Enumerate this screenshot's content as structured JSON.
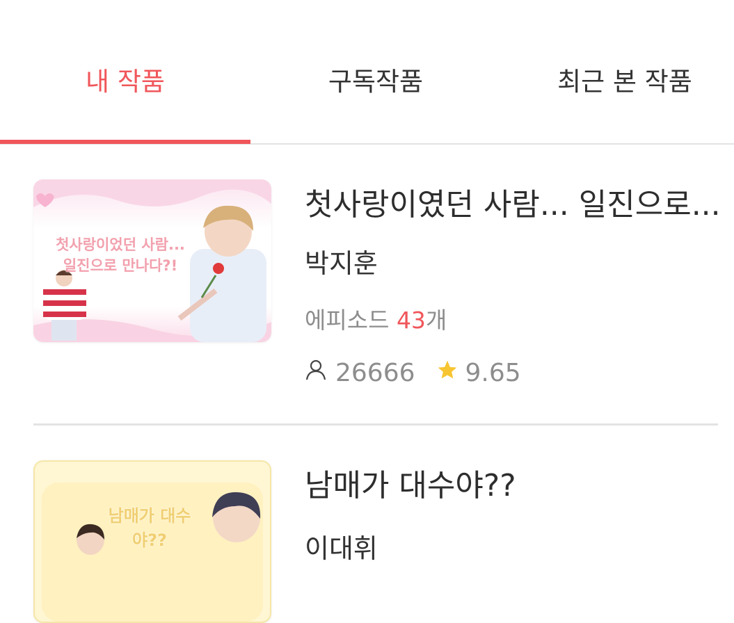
{
  "tabs": [
    {
      "label": "내 작품",
      "active": true
    },
    {
      "label": "구독작품",
      "active": false
    },
    {
      "label": "최근 본 작품",
      "active": false
    }
  ],
  "accent_color": "#f0565a",
  "works": [
    {
      "thumb_text": "첫사랑이었던 사람... 일진으로 만나다?!",
      "title": "첫사랑이였던 사람... 일진으로...",
      "author": "박지훈",
      "episodes_prefix": "에피소드 ",
      "episodes_count": "43",
      "episodes_suffix": "개",
      "views": "26666",
      "rating": "9.65"
    },
    {
      "thumb_text": "남매가 대수야??",
      "title": "남매가 대수야??",
      "author": "이대휘"
    }
  ],
  "icons": {
    "views": "person-icon",
    "rating": "star-icon"
  }
}
